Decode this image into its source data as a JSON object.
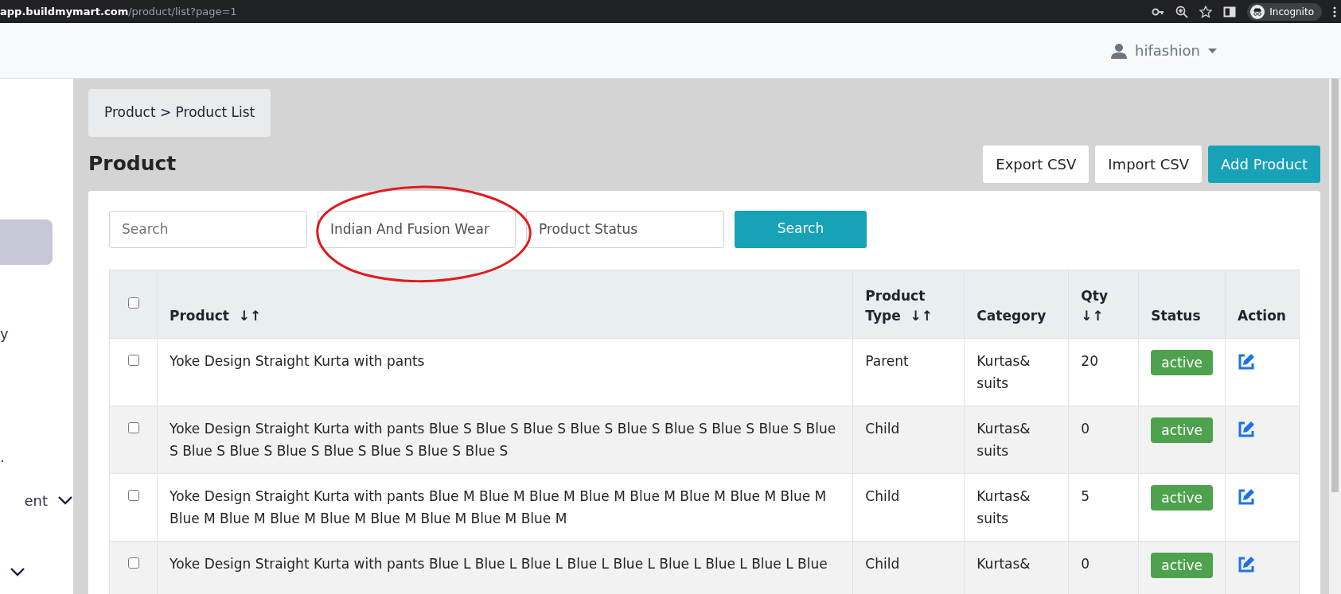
{
  "browser": {
    "url_host": "app.buildmymart.com",
    "url_path": "/product/list?page=1",
    "profile": "Incognito"
  },
  "navbar": {
    "user": "hifashion"
  },
  "sidebar": {
    "items": [
      {
        "selected": true,
        "chevron": false
      },
      {
        "label": "y",
        "selected": false,
        "chevron": false
      },
      {
        "label": ".",
        "selected": false,
        "chevron": false
      },
      {
        "label": "ent",
        "selected": false,
        "chevron": true
      },
      {
        "selected": false,
        "chevron": true
      }
    ]
  },
  "breadcrumb": [
    "Product",
    "Product List"
  ],
  "breadcrumb_separator": ">",
  "page_title": "Product",
  "actions": [
    {
      "label": "Export CSV",
      "kind": "light"
    },
    {
      "label": "Import CSV",
      "kind": "light"
    },
    {
      "label": "Add Product",
      "kind": "primary"
    }
  ],
  "filters": {
    "search": {
      "placeholder": "Search"
    },
    "category": {
      "value": "Indian And Fusion Wear",
      "annotated": true
    },
    "status": {
      "value": "Product Status"
    },
    "button": "Search"
  },
  "table": {
    "select_all": {
      "checked": false
    },
    "columns": [
      {
        "label": "Product",
        "sort": "↓↑"
      },
      {
        "label": "Product Type",
        "sort": "↓↑"
      },
      {
        "label": "Category"
      },
      {
        "label": "Qty",
        "sort": "↓↑"
      },
      {
        "label": "Status"
      },
      {
        "label": "Action"
      }
    ],
    "rows": [
      {
        "checked": false,
        "product": "Yoke Design Straight Kurta with pants",
        "type": "Parent",
        "category": "Kurtas& suits",
        "qty": "20",
        "status": "active"
      },
      {
        "checked": false,
        "product": "Yoke Design Straight Kurta with pants Blue S Blue S Blue S Blue S Blue S Blue S Blue S Blue S Blue S Blue S Blue S Blue S Blue S Blue S Blue S Blue S",
        "type": "Child",
        "category": "Kurtas& suits",
        "qty": "0",
        "status": "active"
      },
      {
        "checked": false,
        "product": "Yoke Design Straight Kurta with pants Blue M Blue M Blue M Blue M Blue M Blue M Blue M Blue M Blue M Blue M Blue M Blue M Blue M Blue M Blue M Blue M",
        "type": "Child",
        "category": "Kurtas& suits",
        "qty": "5",
        "status": "active"
      },
      {
        "checked": false,
        "product": "Yoke Design Straight Kurta with pants Blue L Blue L Blue L Blue L Blue L Blue L Blue L Blue L Blue",
        "type": "Child",
        "category": "Kurtas&",
        "qty": "0",
        "status": "active"
      }
    ]
  }
}
